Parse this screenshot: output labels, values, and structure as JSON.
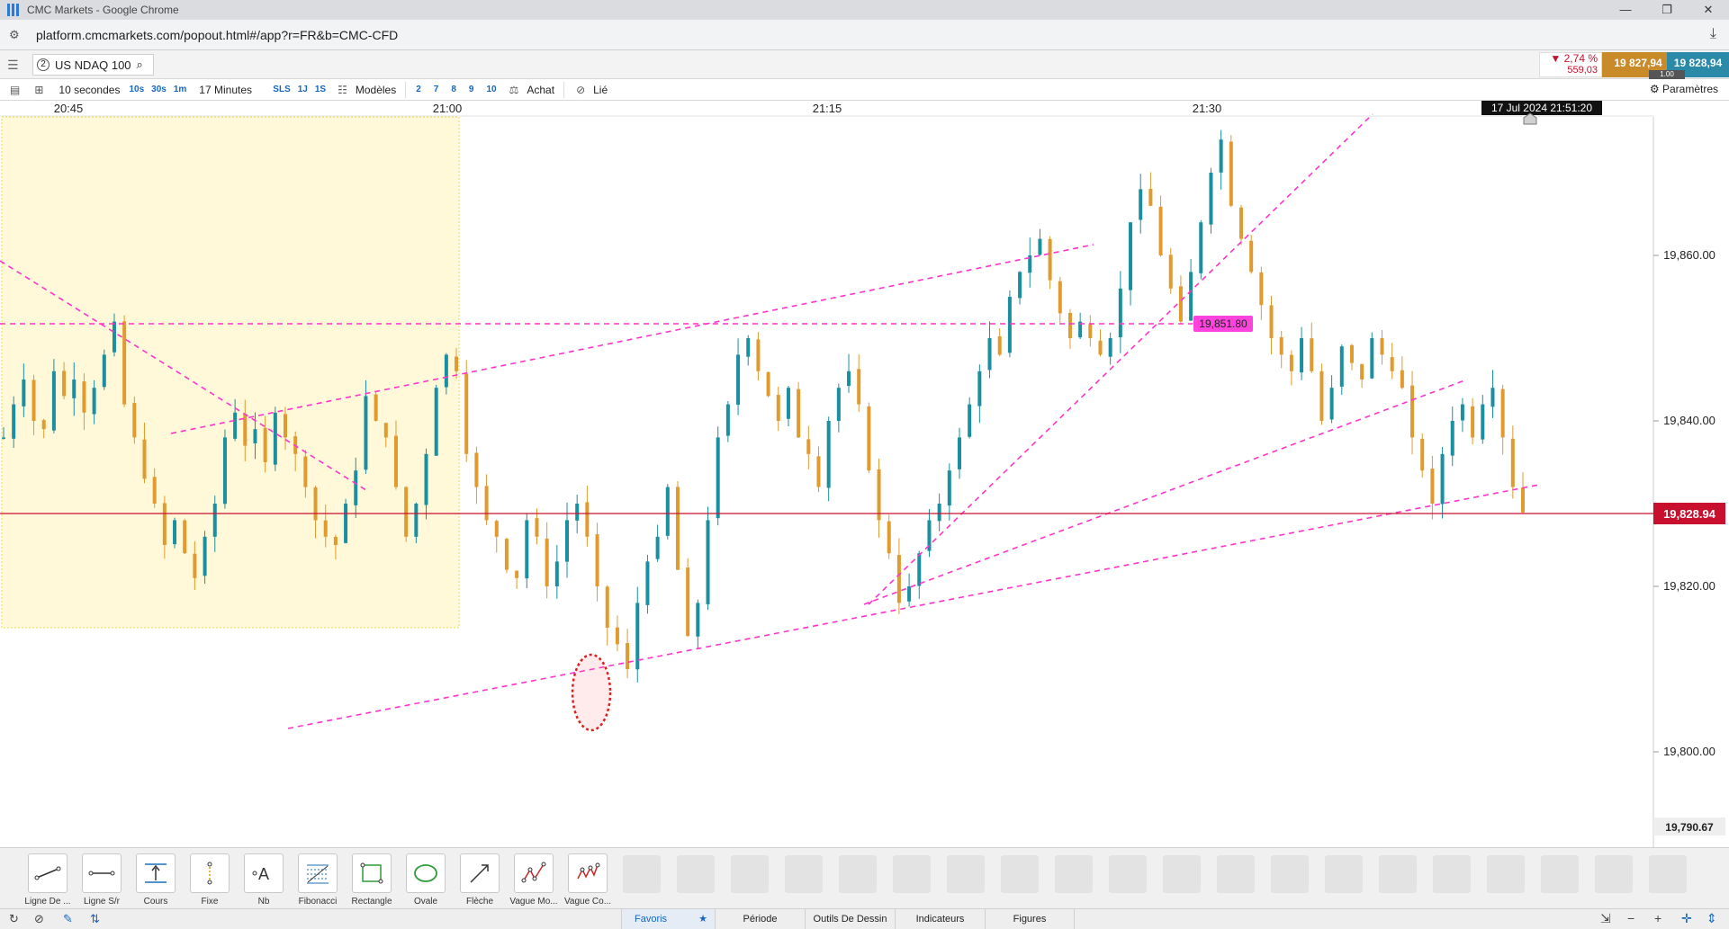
{
  "browser": {
    "window_title": "CMC Markets - Google Chrome",
    "url": "platform.cmcmarkets.com/popout.html#/app?r=FR&b=CMC-CFD"
  },
  "instrument": {
    "badge": "2",
    "symbol": "US NDAQ 100",
    "change_pct": "▼ 2,74 %",
    "change_pts": "559,03",
    "sell": "19 827,94",
    "buy": "19 828,94",
    "spread": "1.00"
  },
  "toolbar": {
    "interval": "10 secondes",
    "intervals": [
      "10s",
      "30s",
      "1m"
    ],
    "range": "17 Minutes",
    "ranges": [
      "SLS",
      "1J",
      "1S"
    ],
    "templates": "Modèles",
    "numbers": [
      "2",
      "7",
      "8",
      "9",
      "10"
    ],
    "buy": "Achat",
    "link": "Lié",
    "settings": "Paramètres"
  },
  "chart_data": {
    "type": "candlestick",
    "instrument": "US NDAQ 100",
    "x_ticks": [
      "20:45",
      "21:00",
      "21:15",
      "21:30"
    ],
    "y_ticks": [
      "19,860.00",
      "19,840.00",
      "19,820.00",
      "19,800.00"
    ],
    "ylim": [
      19790.67,
      19877
    ],
    "crosshair_time": "17 Jul 2024 21:51:20",
    "current_price": "19,828.94",
    "bottom_price": "19,790.67",
    "hline_label": "19,851.80",
    "close_path": [
      19838,
      19842,
      19845,
      19840,
      19839,
      19846,
      19843,
      19845,
      19841,
      19844,
      19848,
      19852,
      19842,
      19838,
      19833,
      19830,
      19825,
      19828,
      19824,
      19821,
      19826,
      19830,
      19838,
      19841,
      19837,
      19839,
      19835,
      19841,
      19838,
      19836,
      19832,
      19828,
      19826,
      19825,
      19830,
      19834,
      19843,
      19840,
      19838,
      19832,
      19826,
      19830,
      19836,
      19844,
      19848,
      19846,
      19836,
      19832,
      19828,
      19826,
      19822,
      19821,
      19828,
      19826,
      19820,
      19823,
      19828,
      19830,
      19826,
      19820,
      19815,
      19813,
      19810,
      19818,
      19823,
      19826,
      19832,
      19822,
      19814,
      19818,
      19828,
      19838,
      19842,
      19848,
      19850,
      19846,
      19843,
      19840,
      19844,
      19838,
      19836,
      19832,
      19840,
      19844,
      19846,
      19842,
      19834,
      19828,
      19824,
      19818,
      19820,
      19824,
      19828,
      19830,
      19834,
      19838,
      19842,
      19846,
      19850,
      19848,
      19855,
      19858,
      19860,
      19862,
      19857,
      19853,
      19850,
      19852,
      19850,
      19848,
      19850,
      19856,
      19864,
      19868,
      19866,
      19860,
      19856,
      19852,
      19858,
      19864,
      19870,
      19874,
      19866,
      19862,
      19858,
      19854,
      19850,
      19848,
      19846,
      19850,
      19846,
      19840,
      19844,
      19849,
      19847,
      19845,
      19850,
      19848,
      19846,
      19844,
      19838,
      19834,
      19830,
      19836,
      19840,
      19842,
      19838,
      19842,
      19844,
      19838,
      19832,
      19828.94
    ],
    "annotations": [
      "dashed magenta trendlines",
      "horizontal dashed line at 19,851.80",
      "red ellipse at session low",
      "shaded time range 20:42–21:01"
    ]
  },
  "tools": [
    {
      "label": "Ligne De ..."
    },
    {
      "label": "Ligne S/r"
    },
    {
      "label": "Cours"
    },
    {
      "label": "Fixe"
    },
    {
      "label": "Nb"
    },
    {
      "label": "Fibonacci"
    },
    {
      "label": "Rectangle"
    },
    {
      "label": "Ovale"
    },
    {
      "label": "Flèche"
    },
    {
      "label": "Vague Mo..."
    },
    {
      "label": "Vague Co..."
    }
  ],
  "bottom_tabs": {
    "favorites": "Favoris",
    "period": "Période",
    "drawing_tools": "Outils De Dessin",
    "indicators": "Indicateurs",
    "figures": "Figures"
  },
  "colors": {
    "up": "#1a8fa0",
    "down": "#e09a2e",
    "trend": "#ff33cc",
    "price_line": "#c8102e",
    "shade": "#fff9d9"
  }
}
